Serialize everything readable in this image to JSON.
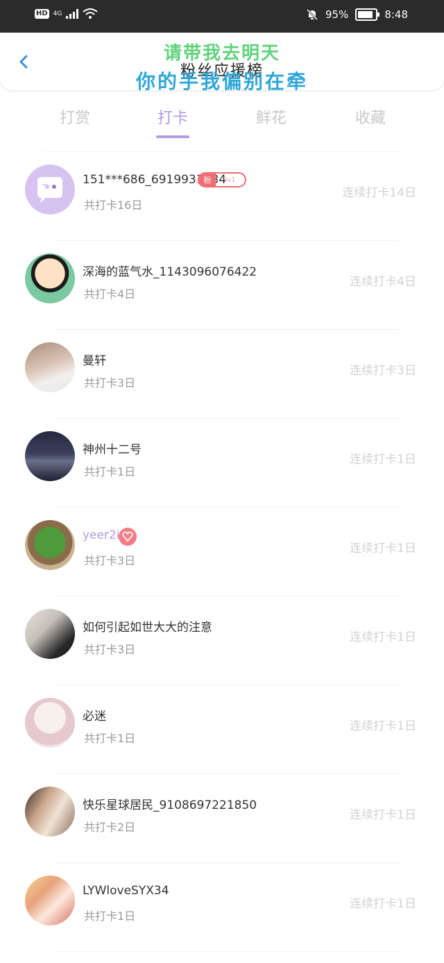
{
  "status_bar": {
    "hd": "HD",
    "network": "4G",
    "battery_percent": "95%",
    "time": "8:48"
  },
  "header": {
    "title": "粉丝应援榜",
    "overlay_line1": "请带我去明天",
    "overlay_line2": "你的手我偏别在牵"
  },
  "tabs": [
    {
      "label": "打赏",
      "active": false
    },
    {
      "label": "打卡",
      "active": true
    },
    {
      "label": "鲜花",
      "active": false
    },
    {
      "label": "收藏",
      "active": false
    }
  ],
  "rows": [
    {
      "name": "151***686_6919931284",
      "sub": "共打卡16日",
      "streak": "连续打卡14日",
      "badge_left": "粉",
      "badge_right": "lv1",
      "avatar": "default-chat-avatar"
    },
    {
      "name": "深海的蓝气水_1143096076422",
      "sub": "共打卡4日",
      "streak": "连续打卡4日",
      "avatar": "crayon-shin-chan-avatar"
    },
    {
      "name": "曼轩",
      "sub": "共打卡3日",
      "streak": "连续打卡3日",
      "avatar": "boy-photo-avatar"
    },
    {
      "name": "神州十二号",
      "sub": "共打卡1日",
      "streak": "连续打卡1日",
      "avatar": "dark-sea-avatar"
    },
    {
      "name": "yeer2i",
      "sub": "共打卡3日",
      "streak": "连续打卡1日",
      "avatar": "green-frog-avatar"
    },
    {
      "name": "如何引起如世大大的注意",
      "sub": "共打卡3日",
      "streak": "连续打卡1日",
      "avatar": "couple-photo-avatar"
    },
    {
      "name": "必迷",
      "sub": "共打卡1日",
      "streak": "连续打卡1日",
      "avatar": "anime-sketch-avatar"
    },
    {
      "name": "快乐星球居民_9108697221850",
      "sub": "共打卡2日",
      "streak": "连续打卡1日",
      "avatar": "boys-photo-avatar"
    },
    {
      "name": "LYWloveSYX34",
      "sub": "共打卡1日",
      "streak": "连续打卡1日",
      "avatar": "friends-photo-avatar"
    }
  ],
  "colors": {
    "accent": "#b59ae0",
    "badge_red": "#ef6e74",
    "muted": "#d2d2d2"
  }
}
